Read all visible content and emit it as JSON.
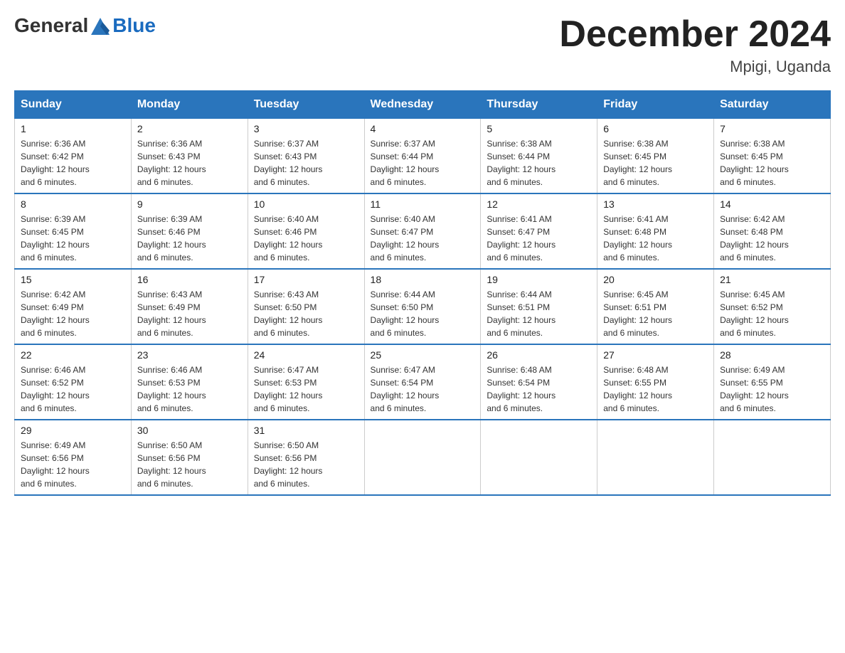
{
  "header": {
    "logo_general": "General",
    "logo_blue": "Blue",
    "title": "December 2024",
    "location": "Mpigi, Uganda"
  },
  "days_of_week": [
    "Sunday",
    "Monday",
    "Tuesday",
    "Wednesday",
    "Thursday",
    "Friday",
    "Saturday"
  ],
  "weeks": [
    [
      {
        "day": "1",
        "sunrise": "6:36 AM",
        "sunset": "6:42 PM",
        "daylight": "12 hours and 6 minutes."
      },
      {
        "day": "2",
        "sunrise": "6:36 AM",
        "sunset": "6:43 PM",
        "daylight": "12 hours and 6 minutes."
      },
      {
        "day": "3",
        "sunrise": "6:37 AM",
        "sunset": "6:43 PM",
        "daylight": "12 hours and 6 minutes."
      },
      {
        "day": "4",
        "sunrise": "6:37 AM",
        "sunset": "6:44 PM",
        "daylight": "12 hours and 6 minutes."
      },
      {
        "day": "5",
        "sunrise": "6:38 AM",
        "sunset": "6:44 PM",
        "daylight": "12 hours and 6 minutes."
      },
      {
        "day": "6",
        "sunrise": "6:38 AM",
        "sunset": "6:45 PM",
        "daylight": "12 hours and 6 minutes."
      },
      {
        "day": "7",
        "sunrise": "6:38 AM",
        "sunset": "6:45 PM",
        "daylight": "12 hours and 6 minutes."
      }
    ],
    [
      {
        "day": "8",
        "sunrise": "6:39 AM",
        "sunset": "6:45 PM",
        "daylight": "12 hours and 6 minutes."
      },
      {
        "day": "9",
        "sunrise": "6:39 AM",
        "sunset": "6:46 PM",
        "daylight": "12 hours and 6 minutes."
      },
      {
        "day": "10",
        "sunrise": "6:40 AM",
        "sunset": "6:46 PM",
        "daylight": "12 hours and 6 minutes."
      },
      {
        "day": "11",
        "sunrise": "6:40 AM",
        "sunset": "6:47 PM",
        "daylight": "12 hours and 6 minutes."
      },
      {
        "day": "12",
        "sunrise": "6:41 AM",
        "sunset": "6:47 PM",
        "daylight": "12 hours and 6 minutes."
      },
      {
        "day": "13",
        "sunrise": "6:41 AM",
        "sunset": "6:48 PM",
        "daylight": "12 hours and 6 minutes."
      },
      {
        "day": "14",
        "sunrise": "6:42 AM",
        "sunset": "6:48 PM",
        "daylight": "12 hours and 6 minutes."
      }
    ],
    [
      {
        "day": "15",
        "sunrise": "6:42 AM",
        "sunset": "6:49 PM",
        "daylight": "12 hours and 6 minutes."
      },
      {
        "day": "16",
        "sunrise": "6:43 AM",
        "sunset": "6:49 PM",
        "daylight": "12 hours and 6 minutes."
      },
      {
        "day": "17",
        "sunrise": "6:43 AM",
        "sunset": "6:50 PM",
        "daylight": "12 hours and 6 minutes."
      },
      {
        "day": "18",
        "sunrise": "6:44 AM",
        "sunset": "6:50 PM",
        "daylight": "12 hours and 6 minutes."
      },
      {
        "day": "19",
        "sunrise": "6:44 AM",
        "sunset": "6:51 PM",
        "daylight": "12 hours and 6 minutes."
      },
      {
        "day": "20",
        "sunrise": "6:45 AM",
        "sunset": "6:51 PM",
        "daylight": "12 hours and 6 minutes."
      },
      {
        "day": "21",
        "sunrise": "6:45 AM",
        "sunset": "6:52 PM",
        "daylight": "12 hours and 6 minutes."
      }
    ],
    [
      {
        "day": "22",
        "sunrise": "6:46 AM",
        "sunset": "6:52 PM",
        "daylight": "12 hours and 6 minutes."
      },
      {
        "day": "23",
        "sunrise": "6:46 AM",
        "sunset": "6:53 PM",
        "daylight": "12 hours and 6 minutes."
      },
      {
        "day": "24",
        "sunrise": "6:47 AM",
        "sunset": "6:53 PM",
        "daylight": "12 hours and 6 minutes."
      },
      {
        "day": "25",
        "sunrise": "6:47 AM",
        "sunset": "6:54 PM",
        "daylight": "12 hours and 6 minutes."
      },
      {
        "day": "26",
        "sunrise": "6:48 AM",
        "sunset": "6:54 PM",
        "daylight": "12 hours and 6 minutes."
      },
      {
        "day": "27",
        "sunrise": "6:48 AM",
        "sunset": "6:55 PM",
        "daylight": "12 hours and 6 minutes."
      },
      {
        "day": "28",
        "sunrise": "6:49 AM",
        "sunset": "6:55 PM",
        "daylight": "12 hours and 6 minutes."
      }
    ],
    [
      {
        "day": "29",
        "sunrise": "6:49 AM",
        "sunset": "6:56 PM",
        "daylight": "12 hours and 6 minutes."
      },
      {
        "day": "30",
        "sunrise": "6:50 AM",
        "sunset": "6:56 PM",
        "daylight": "12 hours and 6 minutes."
      },
      {
        "day": "31",
        "sunrise": "6:50 AM",
        "sunset": "6:56 PM",
        "daylight": "12 hours and 6 minutes."
      },
      null,
      null,
      null,
      null
    ]
  ],
  "labels": {
    "sunrise": "Sunrise:",
    "sunset": "Sunset:",
    "daylight": "Daylight:"
  }
}
